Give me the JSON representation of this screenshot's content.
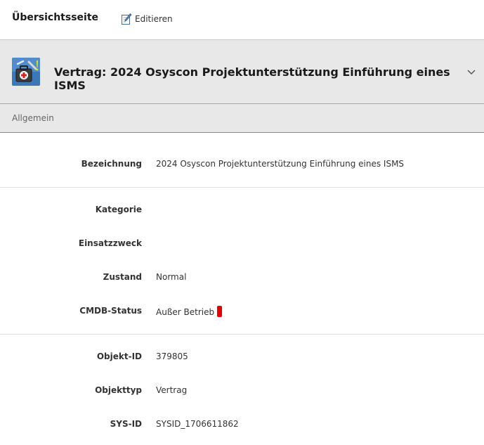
{
  "topbar": {
    "page_title": "Übersichtsseite",
    "edit_label": "Editieren"
  },
  "object": {
    "title": "Vertrag: 2024 Osyscon Projektunterstützung Einführung eines ISMS",
    "icon": "contract-toolbox-icon"
  },
  "section": {
    "label": "Allgemein"
  },
  "fields": {
    "bezeichnung": {
      "label": "Bezeichnung",
      "value": "2024 Osyscon Projektunterstützung Einführung eines ISMS"
    },
    "kategorie": {
      "label": "Kategorie",
      "value": ""
    },
    "einsatzzweck": {
      "label": "Einsatzzweck",
      "value": ""
    },
    "zustand": {
      "label": "Zustand",
      "value": "Normal"
    },
    "cmdb_status": {
      "label": "CMDB-Status",
      "value": "Außer Betrieb",
      "color": "#e60000"
    },
    "objekt_id": {
      "label": "Objekt-ID",
      "value": "379805"
    },
    "objekttyp": {
      "label": "Objekttyp",
      "value": "Vertrag"
    },
    "sys_id": {
      "label": "SYS-ID",
      "value": "SYSID_1706611862"
    }
  },
  "colors": {
    "header_bg": "#e8e8e8",
    "status_red": "#e60000"
  }
}
